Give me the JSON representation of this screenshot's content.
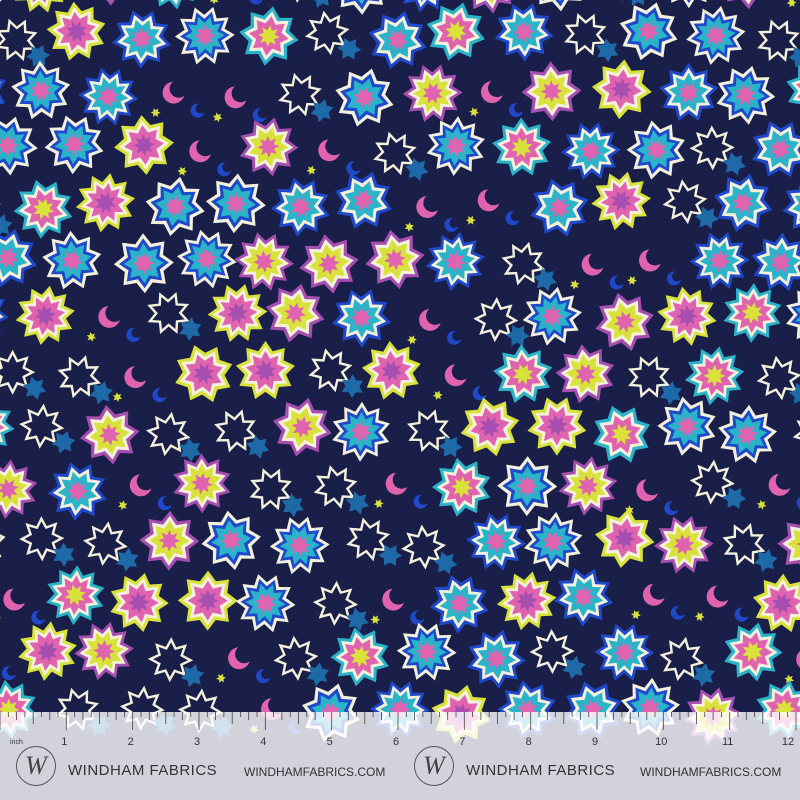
{
  "fabric": {
    "background_color": "#1a1f4a",
    "palette": [
      "#2bb3c9",
      "#e063b0",
      "#d9e23b",
      "#1f49c8",
      "#a64fb0",
      "#f3f1dc",
      "#1e6aa8"
    ],
    "motifs": [
      "star-burst-icon",
      "crescent-moon-icon",
      "small-star-icon",
      "outline-star-icon"
    ]
  },
  "ruler": {
    "unit_label": "inch",
    "numbers": [
      "1",
      "2",
      "3",
      "4",
      "5",
      "6",
      "7",
      "8",
      "9",
      "10",
      "11",
      "12"
    ]
  },
  "watermark": {
    "logo_letter": "W",
    "brand_left": "WINDHAM FABRICS",
    "url_left": "WINDHAMFABRICS.COM",
    "brand_right": "WINDHAM FABRICS",
    "url_right": "WINDHAMFABRICS.COM"
  }
}
